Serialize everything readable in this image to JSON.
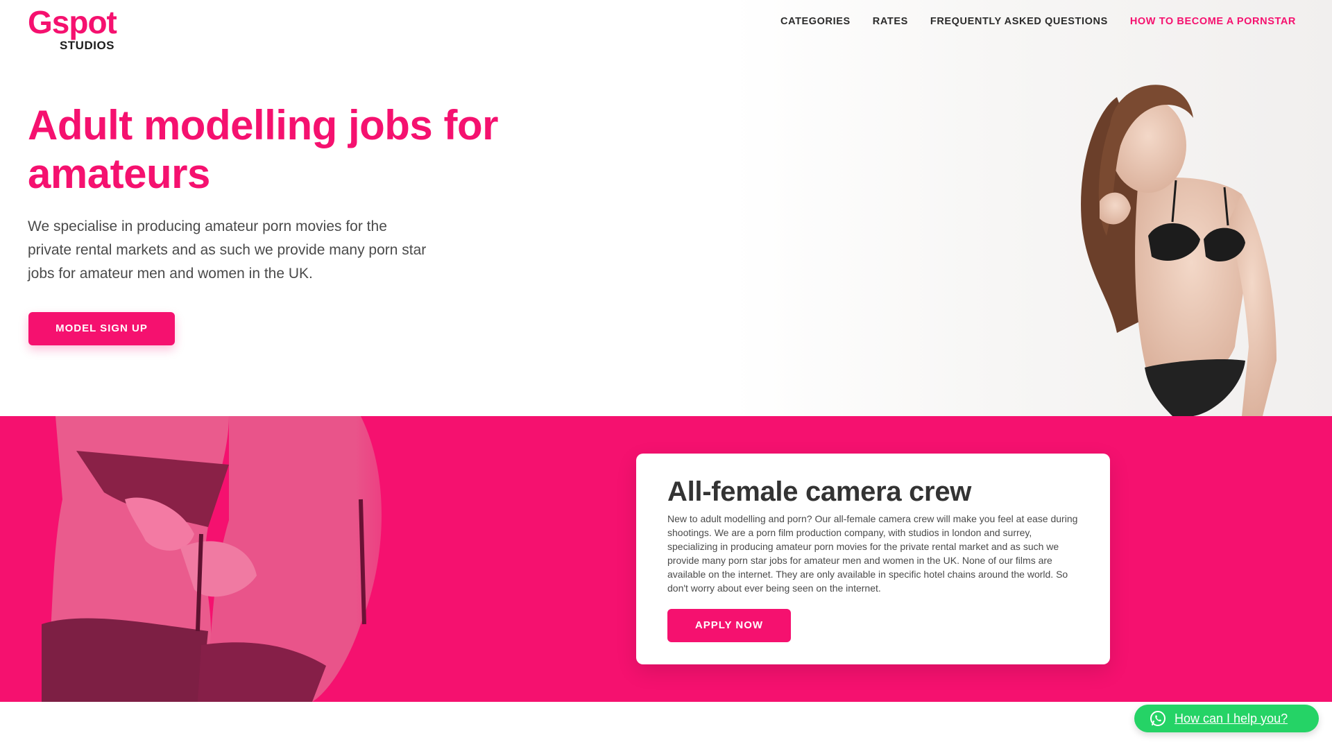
{
  "brand": {
    "name": "Gspot",
    "sub": "STUDIOS"
  },
  "nav": {
    "items": [
      {
        "label": "CATEGORIES"
      },
      {
        "label": "RATES"
      },
      {
        "label": "FREQUENTLY ASKED QUESTIONS"
      },
      {
        "label": "HOW TO BECOME A PORNSTAR"
      }
    ]
  },
  "hero": {
    "title": "Adult modelling jobs for amateurs",
    "text": "We specialise in producing amateur porn movies for the private rental markets and as such we provide many porn star jobs for amateur men and women in the UK.",
    "button": "MODEL SIGN UP"
  },
  "crew": {
    "title": "All-female camera crew",
    "text": "New to adult modelling and porn? Our all-female camera crew will make you feel at ease during shootings. We are a porn film production company, with studios in london and surrey, specializing in producing amateur porn movies for the private rental market and as such we provide many porn star jobs for amateur men and women in the UK. None of our films are available on the internet. They are only available in specific hotel chains around the world. So don't worry about ever being seen on the internet.",
    "button": "APPLY NOW"
  },
  "chat": {
    "label": "How can I help you?",
    "icon": "whatsapp-icon"
  },
  "colors": {
    "accent": "#f5116f",
    "chat": "#25d366"
  }
}
